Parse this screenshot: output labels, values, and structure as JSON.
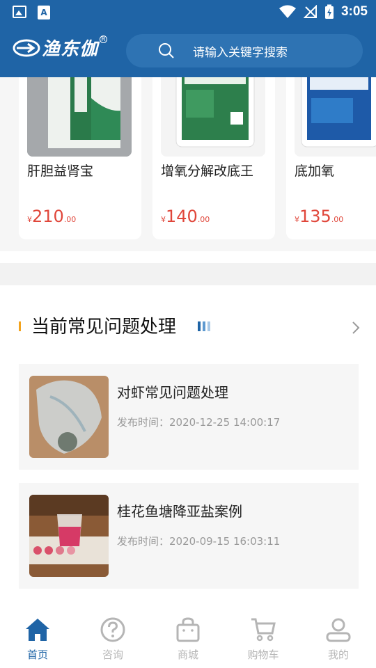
{
  "status_bar": {
    "time": "3:05"
  },
  "header": {
    "logo_text": "渔东伽",
    "logo_reg": "R",
    "search_placeholder": "请输入关键字搜索"
  },
  "products": [
    {
      "name": "肝胆益肾宝",
      "currency": "¥",
      "price_int": "210",
      "price_dec": ".00"
    },
    {
      "name": "增氧分解改底王",
      "currency": "¥",
      "price_int": "140",
      "price_dec": ".00"
    },
    {
      "name": "底加氧",
      "currency": "¥",
      "price_int": "135",
      "price_dec": ".00"
    }
  ],
  "section": {
    "title": "当前常见问题处理"
  },
  "articles": [
    {
      "title": "对虾常见问题处理",
      "meta": "发布时间：2020-12-25 14:00:17"
    },
    {
      "title": "桂花鱼塘降亚盐案例",
      "meta": "发布时间：2020-09-15 16:03:11"
    }
  ],
  "bottom_nav": [
    {
      "label": "首页",
      "icon": "home-icon",
      "active": true
    },
    {
      "label": "咨询",
      "icon": "question-icon",
      "active": false
    },
    {
      "label": "商城",
      "icon": "shopping-bag-icon",
      "active": false
    },
    {
      "label": "购物车",
      "icon": "cart-icon",
      "active": false
    },
    {
      "label": "我的",
      "icon": "user-icon",
      "active": false
    }
  ],
  "colors": {
    "brand_blue": "#1f64a6",
    "price_red": "#e0463a",
    "accent_orange": "#f3a31d"
  }
}
